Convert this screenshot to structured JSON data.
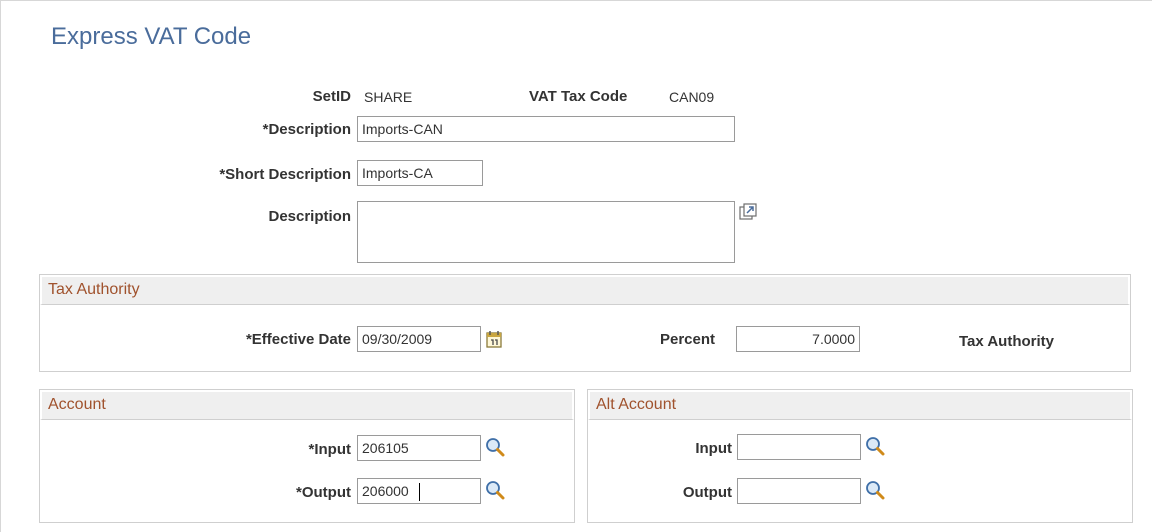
{
  "page": {
    "title": "Express VAT Code"
  },
  "header": {
    "setid_label": "SetID",
    "setid_value": "SHARE",
    "vat_code_label": "VAT Tax Code",
    "vat_code_value": "CAN09"
  },
  "form": {
    "description_label": "*Description",
    "description_value": "Imports-CAN",
    "short_description_label": "*Short Description",
    "short_description_value": "Imports-CA",
    "long_description_label": "Description",
    "long_description_value": ""
  },
  "tax_authority": {
    "section_title": "Tax Authority",
    "effective_date_label": "*Effective Date",
    "effective_date_value": "09/30/2009",
    "percent_label": "Percent",
    "percent_value": "7.0000",
    "tax_authority_label": "Tax Authority"
  },
  "account": {
    "section_title": "Account",
    "input_label": "*Input",
    "input_value": "206105",
    "output_label": "*Output",
    "output_value": "206000"
  },
  "alt_account": {
    "section_title": "Alt Account",
    "input_label": "Input",
    "input_value": "",
    "output_label": "Output",
    "output_value": ""
  },
  "icons": {
    "expand": "expand-icon",
    "calendar": "calendar-icon",
    "lookup": "search-icon"
  },
  "colors": {
    "title": "#4a6c9b",
    "section_title": "#a0522d",
    "section_header_bg": "#efefef"
  }
}
